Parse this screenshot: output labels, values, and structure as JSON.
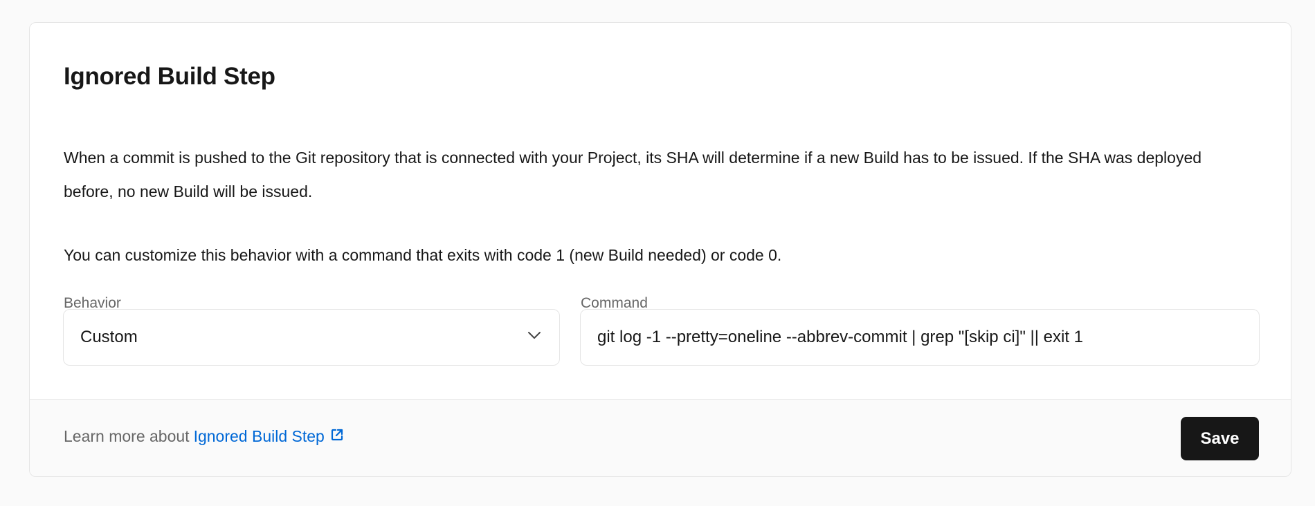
{
  "section": {
    "title": "Ignored Build Step",
    "description": "When a commit is pushed to the Git repository that is connected with your Project, its SHA will determine if a new Build has to be issued. If the SHA was deployed before, no new Build will be issued.",
    "description2": "You can customize this behavior with a command that exits with code 1 (new Build needed) or code 0."
  },
  "behavior": {
    "label": "Behavior",
    "value": "Custom"
  },
  "command": {
    "label": "Command",
    "value": "git log -1 --pretty=oneline --abbrev-commit | grep \"[skip ci]\" || exit 1"
  },
  "footer": {
    "learn_prefix": "Learn more about",
    "learn_link": "Ignored Build Step",
    "save_label": "Save"
  },
  "colors": {
    "link": "#0068d6",
    "button": "#171717"
  }
}
